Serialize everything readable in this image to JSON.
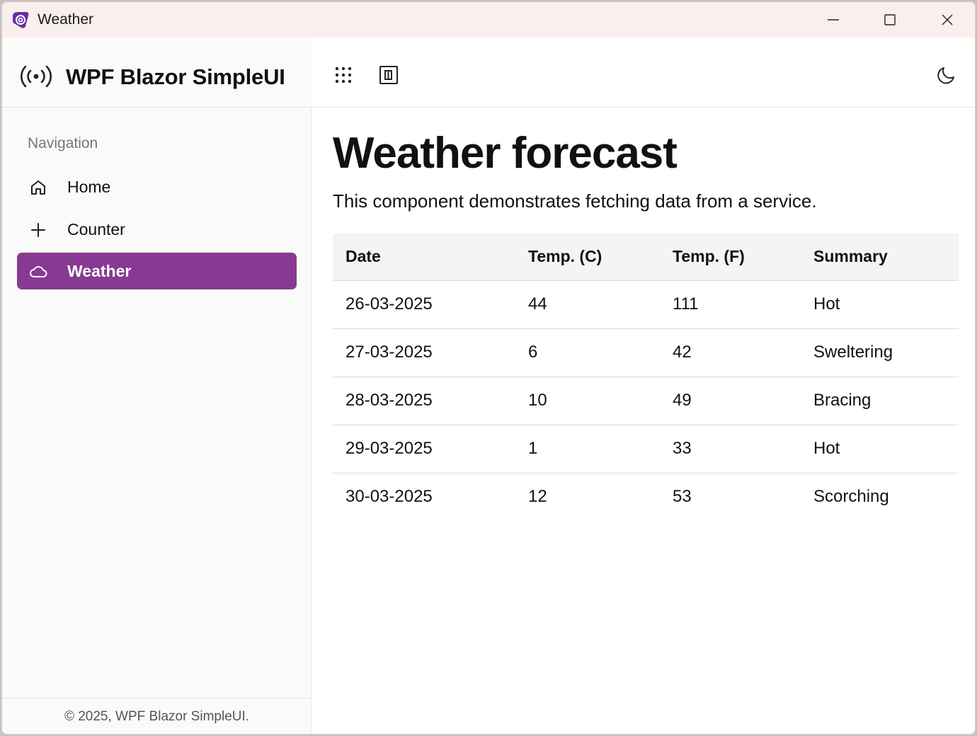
{
  "window": {
    "title": "Weather"
  },
  "sidebar": {
    "brand_title": "WPF Blazor SimpleUI",
    "nav_label": "Navigation",
    "items": [
      {
        "label": "Home",
        "icon": "home-icon",
        "active": false
      },
      {
        "label": "Counter",
        "icon": "plus-icon",
        "active": false
      },
      {
        "label": "Weather",
        "icon": "cloud-icon",
        "active": true
      }
    ],
    "footer": "© 2025, WPF Blazor SimpleUI."
  },
  "main": {
    "title": "Weather forecast",
    "description": "This component demonstrates fetching data from a service.",
    "table": {
      "headers": [
        "Date",
        "Temp. (C)",
        "Temp. (F)",
        "Summary"
      ],
      "rows": [
        [
          "26-03-2025",
          "44",
          "111",
          "Hot"
        ],
        [
          "27-03-2025",
          "6",
          "42",
          "Sweltering"
        ],
        [
          "28-03-2025",
          "10",
          "49",
          "Bracing"
        ],
        [
          "29-03-2025",
          "1",
          "33",
          "Hot"
        ],
        [
          "30-03-2025",
          "12",
          "53",
          "Scorching"
        ]
      ]
    }
  },
  "colors": {
    "accent": "#873a91",
    "titlebar": "#f9efec",
    "sidebar": "#fafafa"
  }
}
